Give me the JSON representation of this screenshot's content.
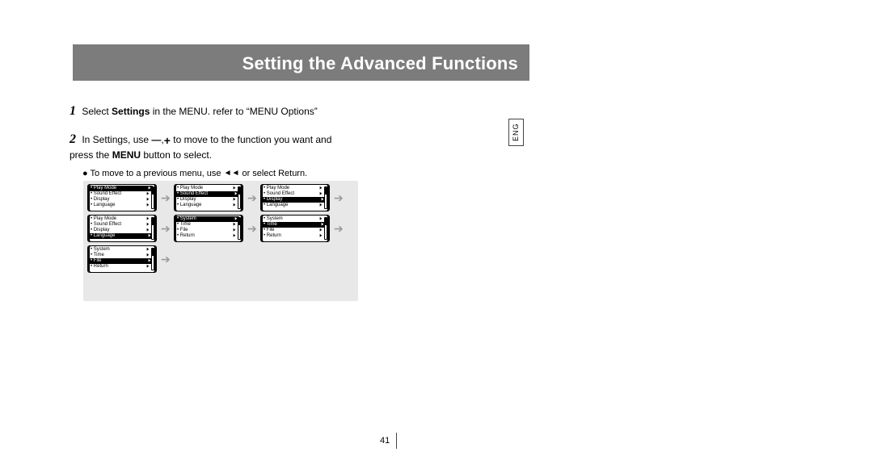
{
  "header": {
    "title": "Setting the Advanced Functions"
  },
  "tab": {
    "label": "ENG"
  },
  "steps": {
    "s1": {
      "num": "1",
      "pre": " Select ",
      "bold": "Settings",
      "post": " in the MENU. refer to “MENU Options”"
    },
    "s2": {
      "num": "2",
      "pre": " In Settings, use ",
      "mid": " to move to the function you want and",
      "line2a": "press the ",
      "line2bold": "MENU",
      "line2b": " button to select.",
      "bullet": "● To move to a previous menu, use ",
      "bulletPost": " or select Return."
    }
  },
  "icons": {
    "minus": "➖",
    "comma": ",",
    "plus": "➕",
    "rewind": "⏮"
  },
  "menuItems": {
    "play": "Play Mode",
    "sound": "Sound Effect",
    "disp": "Display",
    "lang": "Language",
    "sys": "System",
    "time": "Time",
    "file": "File",
    "ret": "Return"
  },
  "arrow": "➔",
  "tri": "▶",
  "dot": "•",
  "pageNumber": "41"
}
